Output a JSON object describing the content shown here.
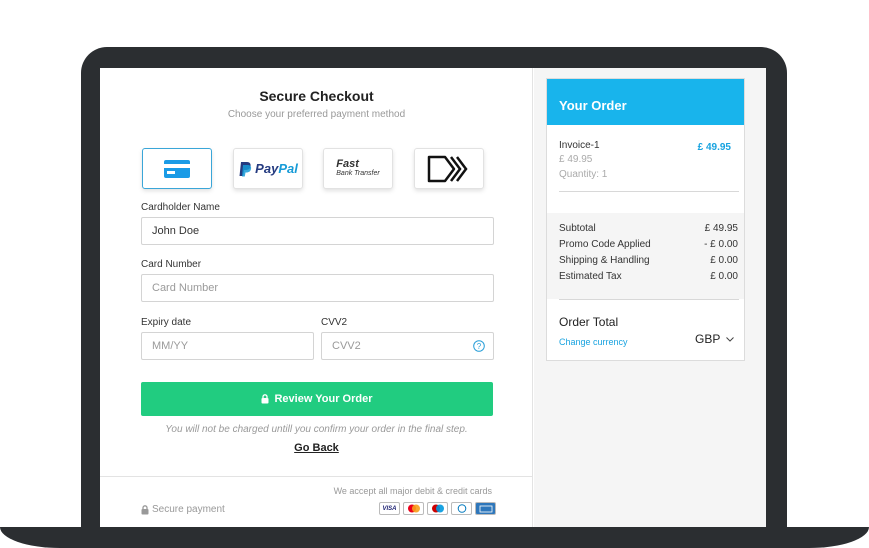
{
  "checkout": {
    "title": "Secure Checkout",
    "subtitle": "Choose your preferred payment method",
    "payment_methods": [
      {
        "name": "card",
        "label": ""
      },
      {
        "name": "paypal",
        "label_a": "Pay",
        "label_b": "Pal"
      },
      {
        "name": "fast-bank-transfer",
        "label_a": "Fast",
        "label_b": "Bank Transfer"
      },
      {
        "name": "contactless",
        "label": ""
      }
    ],
    "cardholder_label": "Cardholder Name",
    "cardholder_value": "John Doe",
    "card_number_label": "Card Number",
    "card_number_placeholder": "Card Number",
    "expiry_label": "Expiry date",
    "expiry_placeholder": "MM/YY",
    "cvv_label": "CVV2",
    "cvv_placeholder": "CVV2",
    "review_button": "Review Your Order",
    "note": "You will not be charged untill you confirm your order in the final step.",
    "go_back": "Go Back",
    "accept_text": "We accept all major debit & credit cards",
    "secure_text": "Secure payment",
    "card_logos": [
      "VISA",
      "mastercard",
      "maestro",
      "diners",
      "amex"
    ],
    "accent_color": "#21cc80"
  },
  "order": {
    "header": "Your Order",
    "header_color": "#18b4ec",
    "item": {
      "name": "Invoice-1",
      "price": "£ 49.95",
      "price_sub": "£ 49.95",
      "quantity": "Quantity: 1"
    },
    "summary": [
      {
        "label": "Subtotal",
        "value": "£ 49.95"
      },
      {
        "label": "Promo Code Applied",
        "value": "- £ 0.00"
      },
      {
        "label": "Shipping & Handling",
        "value": "£ 0.00"
      },
      {
        "label": "Estimated Tax",
        "value": "£ 0.00"
      }
    ],
    "total_label": "Order Total",
    "change_currency": "Change currency",
    "currency": "GBP"
  }
}
